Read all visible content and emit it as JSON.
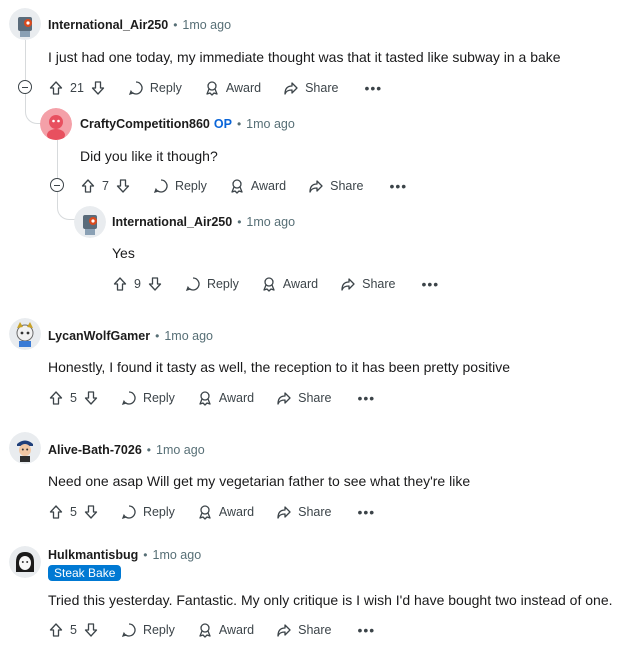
{
  "labels": {
    "reply": "Reply",
    "award": "Award",
    "share": "Share",
    "more": "•••"
  },
  "comments": [
    {
      "author": "International_Air250",
      "time": "1mo ago",
      "text": "I just had one today, my immediate thought was that it tasted like subway in a bake",
      "votes": "21"
    },
    {
      "author": "CraftyCompetition860",
      "op": "OP",
      "time": "1mo ago",
      "text": "Did you like it though?",
      "votes": "7"
    },
    {
      "author": "International_Air250",
      "time": "1mo ago",
      "text": "Yes",
      "votes": "9"
    },
    {
      "author": "LycanWolfGamer",
      "time": "1mo ago",
      "text": "Honestly, I found it tasty as well, the reception to it has been pretty positive",
      "votes": "5"
    },
    {
      "author": "Alive-Bath-7026",
      "time": "1mo ago",
      "text": "Need one asap Will get my vegetarian father to see what they're like",
      "votes": "5"
    },
    {
      "author": "Hulkmantisbug",
      "time": "1mo ago",
      "flair": "Steak Bake",
      "text": "Tried this yesterday. Fantastic. My only critique is I wish I'd have bought two instead of one.",
      "votes": "5"
    }
  ],
  "colors": {
    "accent": "#0079d3",
    "op": "#0a65d8",
    "thread_line": "#d7dadc",
    "muted": "#576f76"
  },
  "icons": [
    "upvote-icon",
    "downvote-icon",
    "reply-icon",
    "award-icon",
    "share-icon",
    "collapse-icon"
  ]
}
